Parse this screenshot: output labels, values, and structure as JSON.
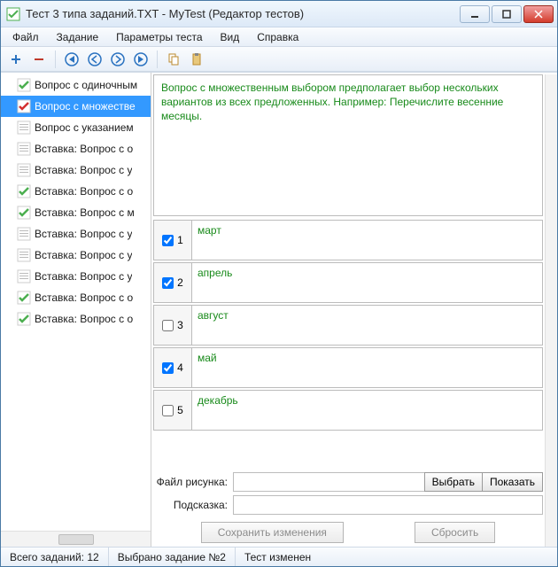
{
  "window": {
    "title": "Тест 3 типа заданий.TXT - MyTest (Редактор тестов)"
  },
  "menu": {
    "file": "Файл",
    "task": "Задание",
    "params": "Параметры теста",
    "view": "Вид",
    "help": "Справка"
  },
  "sidebar": {
    "items": [
      {
        "label": "Вопрос с одиночным",
        "selected": false,
        "icon": "green"
      },
      {
        "label": "Вопрос с множестве",
        "selected": true,
        "icon": "red"
      },
      {
        "label": "Вопрос с указанием",
        "selected": false,
        "icon": "gray"
      },
      {
        "label": "Вставка: Вопрос с о",
        "selected": false,
        "icon": "gray"
      },
      {
        "label": "Вставка: Вопрос с у",
        "selected": false,
        "icon": "gray"
      },
      {
        "label": "Вставка: Вопрос с о",
        "selected": false,
        "icon": "green"
      },
      {
        "label": "Вставка: Вопрос с м",
        "selected": false,
        "icon": "green"
      },
      {
        "label": "Вставка: Вопрос с у",
        "selected": false,
        "icon": "gray"
      },
      {
        "label": "Вставка: Вопрос с у",
        "selected": false,
        "icon": "gray"
      },
      {
        "label": "Вставка: Вопрос с у",
        "selected": false,
        "icon": "gray"
      },
      {
        "label": "Вставка: Вопрос с о",
        "selected": false,
        "icon": "green"
      },
      {
        "label": "Вставка: Вопрос с о",
        "selected": false,
        "icon": "green"
      }
    ]
  },
  "editor": {
    "question_text": "Вопрос с множественным выбором предполагает выбор нескольких вариантов из всех предложенных. Например: Перечислите весенние месяцы.",
    "answers": [
      {
        "num": "1",
        "checked": true,
        "text": "март"
      },
      {
        "num": "2",
        "checked": true,
        "text": "апрель"
      },
      {
        "num": "3",
        "checked": false,
        "text": "август"
      },
      {
        "num": "4",
        "checked": true,
        "text": "май"
      },
      {
        "num": "5",
        "checked": false,
        "text": "декабрь"
      }
    ],
    "image_label": "Файл рисунка:",
    "image_value": "",
    "btn_choose": "Выбрать",
    "btn_show": "Показать",
    "hint_label": "Подсказка:",
    "hint_value": "",
    "btn_save": "Сохранить изменения",
    "btn_reset": "Сбросить"
  },
  "status": {
    "total": "Всего заданий: 12",
    "selected": "Выбрано задание №2",
    "changed": "Тест изменен"
  }
}
